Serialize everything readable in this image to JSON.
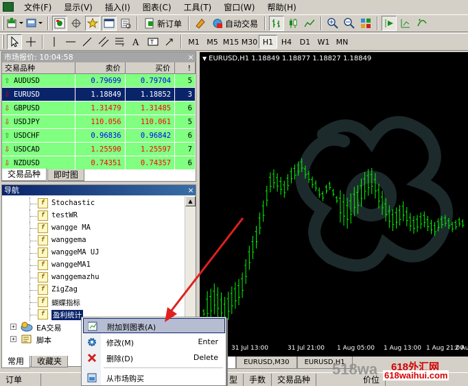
{
  "menubar": {
    "items": [
      "文件(F)",
      "显示(V)",
      "插入(I)",
      "图表(C)",
      "工具(T)",
      "窗口(W)",
      "帮助(H)"
    ]
  },
  "toolbar": {
    "new_order": "新订单",
    "auto_trading": "自动交易",
    "periods": [
      "M1",
      "M5",
      "M15",
      "M30",
      "H1",
      "H4",
      "D1",
      "W1",
      "MN"
    ],
    "active_period": "H1"
  },
  "market_watch": {
    "caption": "市场报价: 10:04:58",
    "columns": [
      "交易品种",
      "卖价",
      "买价",
      "!"
    ],
    "rows": [
      {
        "symbol": "AUDUSD",
        "bid": "0.79699",
        "ask": "0.79704",
        "spread": "5",
        "dir": "up"
      },
      {
        "symbol": "EURUSD",
        "bid": "1.18849",
        "ask": "1.18852",
        "spread": "3",
        "dir": "down"
      },
      {
        "symbol": "GBPUSD",
        "bid": "1.31479",
        "ask": "1.31485",
        "spread": "6",
        "dir": "down"
      },
      {
        "symbol": "USDJPY",
        "bid": "110.056",
        "ask": "110.061",
        "spread": "5",
        "dir": "down"
      },
      {
        "symbol": "USDCHF",
        "bid": "0.96836",
        "ask": "0.96842",
        "spread": "6",
        "dir": "up"
      },
      {
        "symbol": "USDCAD",
        "bid": "1.25590",
        "ask": "1.25597",
        "spread": "7",
        "dir": "down"
      },
      {
        "symbol": "NZDUSD",
        "bid": "0.74351",
        "ask": "0.74357",
        "spread": "6",
        "dir": "down"
      }
    ],
    "tabs": [
      "交易品种",
      "即时图"
    ]
  },
  "navigator": {
    "caption": "导航",
    "indicators": [
      "Stochastic",
      "testWR",
      "wangge MA",
      "wanggema",
      "wanggeMA UJ",
      "wanggeMA1",
      "wanggemazhu",
      "ZigZag",
      "蝴蝶指标",
      "盈利统计"
    ],
    "selected": "盈利统计",
    "folders": [
      "EA交易",
      "脚本"
    ],
    "tabs": [
      "常用",
      "收藏夹"
    ]
  },
  "chart": {
    "title": "EURUSD,H1  1.18849 1.18877 1.18827 1.18849",
    "x_labels": [
      "7",
      "31 Jul 13:00",
      "31 Jul 21:00",
      "1 Aug 05:00",
      "1 Aug 13:00",
      "1 Aug 21:00",
      "2 Aug 05:00"
    ],
    "tabs": [
      "SD,H1",
      "EURUSD,M30",
      "EURUSD,H1"
    ]
  },
  "context_menu": {
    "items": [
      {
        "label": "附加到图表(A)",
        "shortcut": ""
      },
      {
        "label": "修改(M)",
        "shortcut": "Enter"
      },
      {
        "label": "删除(D)",
        "shortcut": "Delete"
      },
      {
        "label": "从市场购买",
        "shortcut": ""
      }
    ]
  },
  "bottom_bar": {
    "items": [
      "订单",
      "型",
      "手数",
      "交易品种",
      "价位"
    ]
  },
  "brand": {
    "left": "518wa",
    "top": "618外汇网",
    "bottom": "618waihui.com"
  },
  "colors": {
    "accent_green": "#80ff80",
    "selection_blue": "#0a246a",
    "candle_green": "#00ff00",
    "arrow_red": "#e02020"
  }
}
